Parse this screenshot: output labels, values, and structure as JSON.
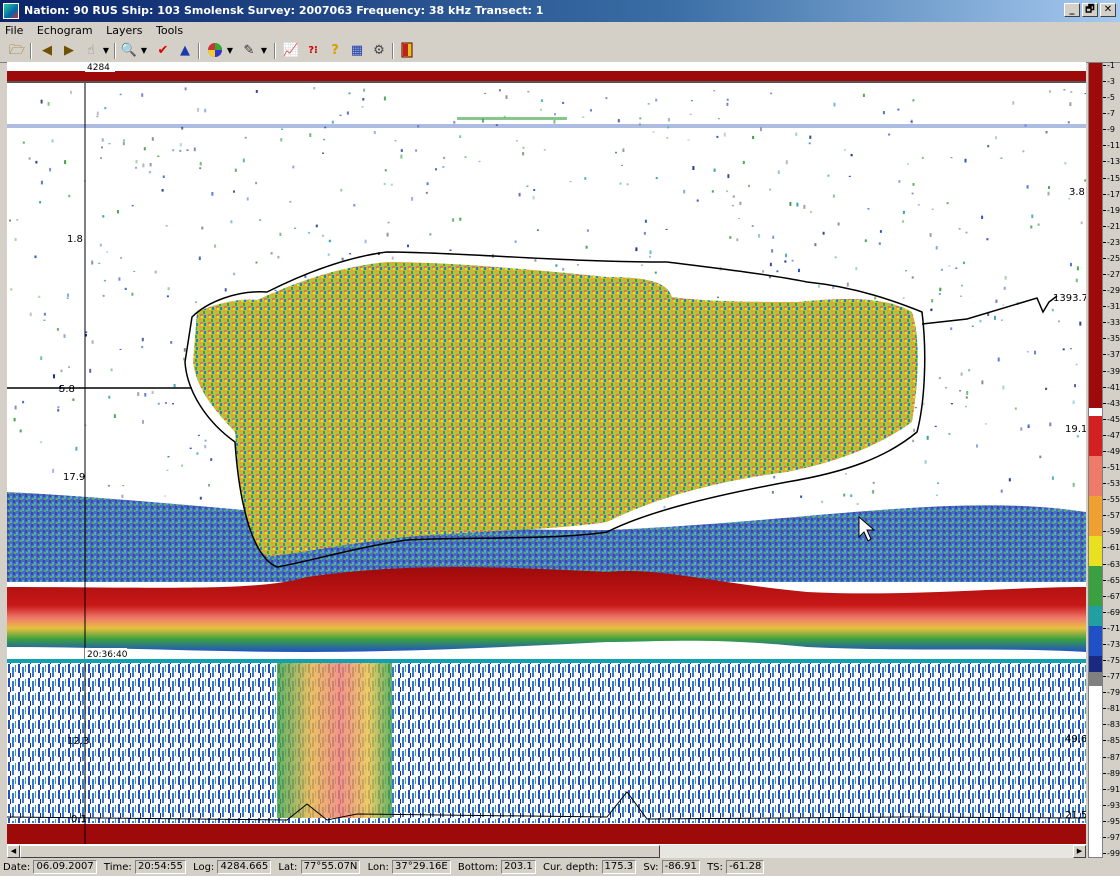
{
  "window": {
    "title": "Nation: 90 RUS  Ship: 103 Smolensk  Survey: 2007063  Frequency: 38 kHz  Transect: 1",
    "minimize": "_",
    "maximize": "🗗",
    "close": "✕"
  },
  "menu": {
    "file": "File",
    "echogram": "Echogram",
    "layers": "Layers",
    "tools": "Tools"
  },
  "toolbar": {
    "icons": [
      "open-folder-icon",
      "back-icon",
      "forward-icon",
      "hand-icon",
      "zoom-icon",
      "check-icon",
      "peak-icon",
      "color-wheel-icon",
      "pen-icon",
      "chart-icon",
      "query-icon",
      "help-icon",
      "table-icon",
      "settings-icon",
      "exit-icon"
    ]
  },
  "echogram": {
    "log_marker": "4284",
    "time_marker": "20:36:40",
    "left_labels": [
      "1.8",
      "5.8",
      "17.9",
      "12.3",
      "0.1"
    ],
    "right_labels": [
      "3.8",
      "1393.7",
      "19.1",
      "49.6",
      "21.5"
    ],
    "colors": {
      "dark_red": "#9e0a0a",
      "red": "#d42020",
      "salmon": "#f07a6a",
      "orange": "#f0a030",
      "yellow": "#e8e020",
      "green": "#3aa040",
      "teal": "#20a0a0",
      "blue": "#2050c8",
      "navy": "#1a2a80",
      "grey": "#808080"
    }
  },
  "colorbar": {
    "ticks": [
      "-1",
      "-3",
      "-5",
      "-7",
      "-9",
      "-11",
      "-13",
      "-15",
      "-17",
      "-19",
      "-21",
      "-23",
      "-25",
      "-27",
      "-29",
      "-31",
      "-33",
      "-35",
      "-37",
      "-39",
      "-41",
      "-43",
      "-45",
      "-47",
      "-49",
      "-51",
      "-53",
      "-55",
      "-57",
      "-59",
      "-61",
      "-63",
      "-65",
      "-67",
      "-69",
      "-71",
      "-73",
      "-75",
      "-77",
      "-79",
      "-81",
      "-83",
      "-85",
      "-87",
      "-89",
      "-91",
      "-93",
      "-95",
      "-97",
      "-99"
    ]
  },
  "status": {
    "date_label": "Date:",
    "date": "06.09.2007",
    "time_label": "Time:",
    "time": "20:54:55",
    "log_label": "Log:",
    "log": "4284.665",
    "lat_label": "Lat:",
    "lat": "77°55.07N",
    "lon_label": "Lon:",
    "lon": "37°29.16E",
    "bottom_label": "Bottom:",
    "bottom": "203.1",
    "cur_depth_label": "Cur. depth:",
    "cur_depth": "175.3",
    "sv_label": "Sv:",
    "sv": "-86.91",
    "ts_label": "TS:",
    "ts": "-61.28"
  }
}
